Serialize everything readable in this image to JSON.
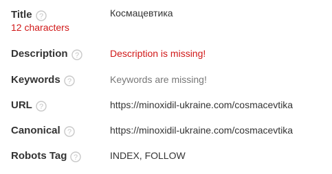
{
  "rows": [
    {
      "label": "Title",
      "note": "12 characters",
      "value": "Космацевтика",
      "status": "normal"
    },
    {
      "label": "Description",
      "value": "Description is missing!",
      "status": "error"
    },
    {
      "label": "Keywords",
      "value": "Keywords are missing!",
      "status": "muted"
    },
    {
      "label": "URL",
      "value": "https://minoxidil-ukraine.com/cosmacevtika",
      "status": "normal"
    },
    {
      "label": "Canonical",
      "value": "https://minoxidil-ukraine.com/cosmacevtika",
      "status": "normal"
    },
    {
      "label": "Robots Tag",
      "value": "INDEX, FOLLOW",
      "status": "normal"
    }
  ],
  "colors": {
    "label": "#333333",
    "value": "#333333",
    "error": "#d01717",
    "muted": "#777777",
    "help_icon": "#c8c8c8"
  },
  "icons": {
    "help": "question-mark-circle-icon"
  }
}
